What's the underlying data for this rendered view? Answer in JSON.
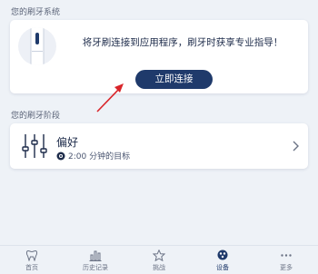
{
  "system_section": {
    "title": "您的刷牙系统",
    "connect_message": "将牙刷连接到应用程序，刷牙时获享专业指导！",
    "connect_button_label": "立即连接"
  },
  "stage_section": {
    "title": "您的刷牙阶段",
    "preference_title": "偏好",
    "goal_text": "2:00 分钟的目标"
  },
  "bottom_nav": {
    "items": [
      {
        "label": "首页",
        "icon": "tooth-icon"
      },
      {
        "label": "历史记录",
        "icon": "bar-chart-icon"
      },
      {
        "label": "挑战",
        "icon": "star-icon"
      },
      {
        "label": "设备",
        "icon": "device-icon",
        "active": true
      },
      {
        "label": "更多",
        "icon": "more-dots-icon"
      }
    ]
  },
  "colors": {
    "primary": "#1f3a6b",
    "background": "#eef2f7",
    "annotation_arrow": "#d9252a"
  }
}
